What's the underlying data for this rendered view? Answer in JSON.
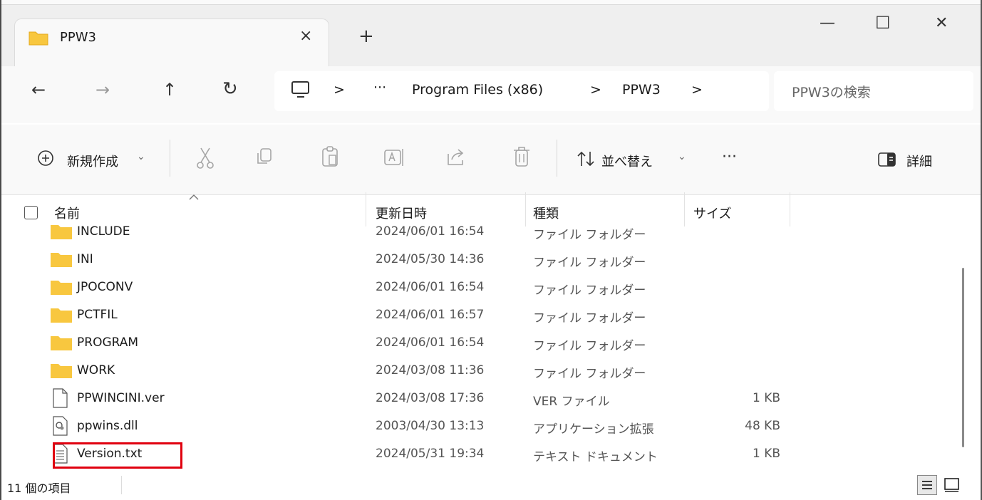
{
  "window": {
    "tab_title": "PPW3",
    "tab_close": "×",
    "new_tab": "+",
    "minimize": "—",
    "maximize": "☐",
    "close": "✕"
  },
  "nav": {
    "back": "←",
    "forward": "→",
    "up": "↑",
    "refresh": "↻",
    "breadcrumb_more": "···",
    "breadcrumbs": [
      "Program Files (x86)",
      "PPW3"
    ],
    "separator": ">",
    "search_placeholder": "PPW3の検索"
  },
  "toolbar": {
    "new_label": "新規作成",
    "sort_label": "並べ替え",
    "more": "···",
    "details_label": "詳細"
  },
  "columns": {
    "name": "名前",
    "date": "更新日時",
    "type": "種類",
    "size": "サイズ"
  },
  "files": [
    {
      "name": "INCLUDE",
      "date": "2024/06/01 16:54",
      "type": "ファイル フォルダー",
      "size": "",
      "icon": "folder-icon"
    },
    {
      "name": "INI",
      "date": "2024/05/30 14:36",
      "type": "ファイル フォルダー",
      "size": "",
      "icon": "folder-icon"
    },
    {
      "name": "JPOCONV",
      "date": "2024/06/01 16:54",
      "type": "ファイル フォルダー",
      "size": "",
      "icon": "folder-icon"
    },
    {
      "name": "PCTFIL",
      "date": "2024/06/01 16:57",
      "type": "ファイル フォルダー",
      "size": "",
      "icon": "folder-icon"
    },
    {
      "name": "PROGRAM",
      "date": "2024/06/01 16:54",
      "type": "ファイル フォルダー",
      "size": "",
      "icon": "folder-icon"
    },
    {
      "name": "WORK",
      "date": "2024/03/08 11:36",
      "type": "ファイル フォルダー",
      "size": "",
      "icon": "folder-icon"
    },
    {
      "name": "PPWINCINI.ver",
      "date": "2024/03/08 17:36",
      "type": "VER ファイル",
      "size": "1 KB",
      "icon": "file-icon"
    },
    {
      "name": "ppwins.dll",
      "date": "2003/04/30 13:13",
      "type": "アプリケーション拡張",
      "size": "48 KB",
      "icon": "dll-file-icon"
    },
    {
      "name": "Version.txt",
      "date": "2024/05/31 19:34",
      "type": "テキスト ドキュメント",
      "size": "1 KB",
      "icon": "text-file-icon"
    }
  ],
  "status": {
    "item_count": "11 個の項目"
  },
  "colors": {
    "folder": "#f8c73f",
    "highlight_box": "#e0000f",
    "accent": "#0067c0"
  }
}
